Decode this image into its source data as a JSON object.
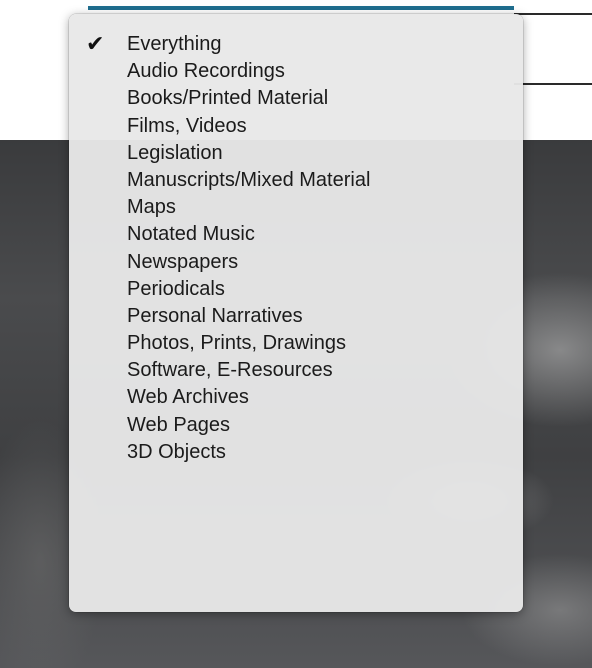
{
  "search_filter": {
    "selected": "Everything",
    "options": [
      "Everything",
      "Audio Recordings",
      "Books/Printed Material",
      "Films, Videos",
      "Legislation",
      "Manuscripts/Mixed Material",
      "Maps",
      "Notated Music",
      "Newspapers",
      "Periodicals",
      "Personal Narratives",
      "Photos, Prints, Drawings",
      "Software, E-Resources",
      "Web Archives",
      "Web Pages",
      "3D Objects"
    ]
  },
  "icons": {
    "selected_marker": "checkmark-icon",
    "selected_marker_glyph": "✔"
  },
  "colors": {
    "accent": "#1f6e8f",
    "menu_background": "#e8e8e8",
    "menu_text": "#1b1b1b"
  }
}
